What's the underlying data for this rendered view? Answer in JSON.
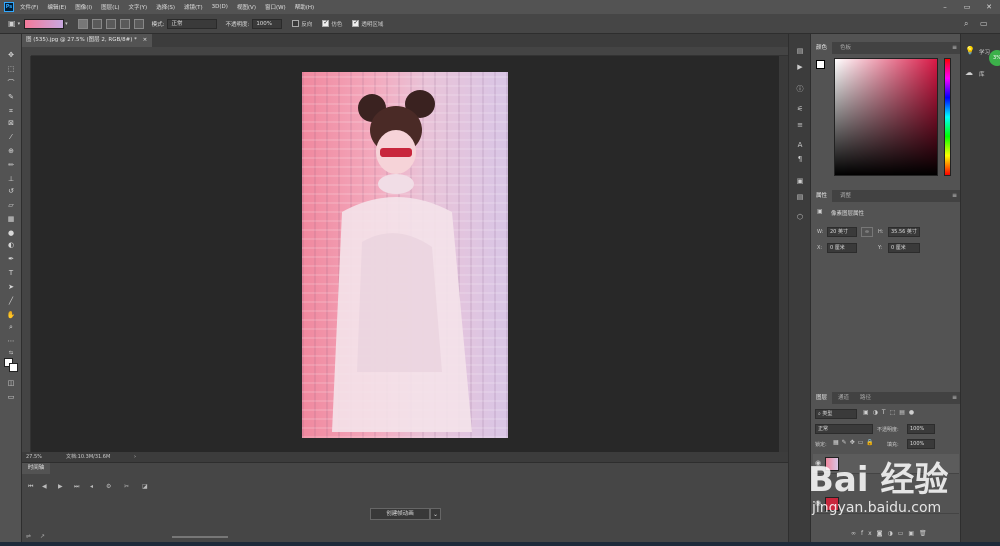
{
  "app": {
    "logo": "Ps",
    "menu": [
      "文件(F)",
      "编辑(E)",
      "图像(I)",
      "图层(L)",
      "文字(Y)",
      "选择(S)",
      "滤镜(T)",
      "3D(D)",
      "视图(V)",
      "窗口(W)",
      "帮助(H)"
    ]
  },
  "options": {
    "mode_label": "模式:",
    "mode_value": "正常",
    "opacity_label": "不透明度:",
    "opacity_value": "100%",
    "reverse_label": "反向",
    "dither_label": "仿色",
    "transparency_label": "透明区域"
  },
  "document": {
    "tab_title": "图 (535).jpg @ 27.5% (图层 2, RGB/8#) *",
    "zoom": "27.5%",
    "doc_size": "文档:10.3M/31.6M"
  },
  "timeline": {
    "tab_label": "时间轴",
    "create_button": "创建帧动画"
  },
  "color_panel": {
    "tabs": [
      "颜色",
      "色板"
    ],
    "accent": "#d81845"
  },
  "properties_panel": {
    "tabs": [
      "属性",
      "调整"
    ],
    "header": "像素图层属性",
    "w_label": "W:",
    "w_value": "20 英寸",
    "h_label": "H:",
    "h_value": "35.56 英寸",
    "x_label": "X:",
    "x_value": "0 厘米",
    "y_label": "Y:",
    "y_value": "0 厘米",
    "link_icon": "link-icon"
  },
  "layers_panel": {
    "tabs": [
      "图层",
      "通道",
      "路径"
    ],
    "filter_value": "类型",
    "blend_value": "正常",
    "opacity_label": "不透明度:",
    "opacity_value": "100%",
    "lock_label": "锁定:",
    "fill_label": "填充:",
    "fill_value": "100%"
  },
  "right_strip": {
    "learn_label": "学习",
    "library_label": "库",
    "badge": "3%"
  },
  "watermark": {
    "brand": "Bai 经验",
    "url": "jingyan.baidu.com"
  }
}
